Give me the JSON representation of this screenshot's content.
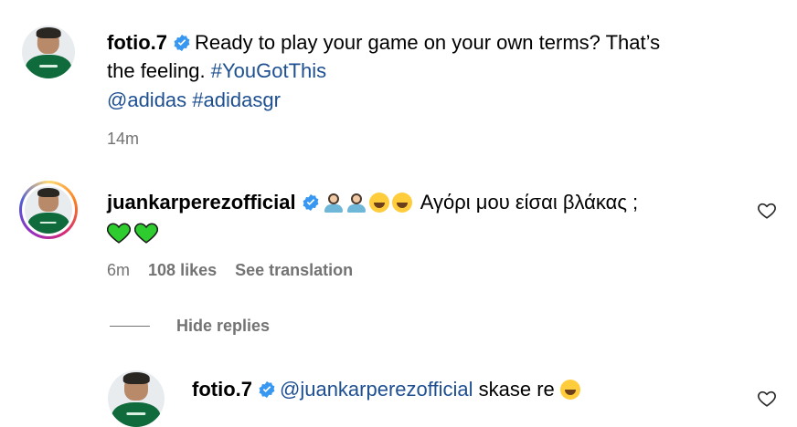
{
  "caption": {
    "username": "fotio.7",
    "text_part1": "Ready to play your game on your own terms? That’s",
    "text_part2": "the feeling.",
    "hashtag1": "#YouGotThis",
    "mention": "@adidas",
    "hashtag2": "#adidasgr",
    "time": "14m"
  },
  "comment": {
    "username": "juankarperezofficial",
    "text": "Αγόρι μου είσαι βλάκας ;",
    "time": "6m",
    "likes": "108 likes",
    "translate": "See translation"
  },
  "replies": {
    "hide_label": "Hide replies"
  },
  "reply": {
    "username": "fotio.7",
    "mention": "@juankarperezofficial",
    "text": "skase re"
  },
  "colors": {
    "link": "#1d4f91",
    "meta": "#737373",
    "verified": "#3897f0",
    "green_heart": "#2ecc2e"
  }
}
